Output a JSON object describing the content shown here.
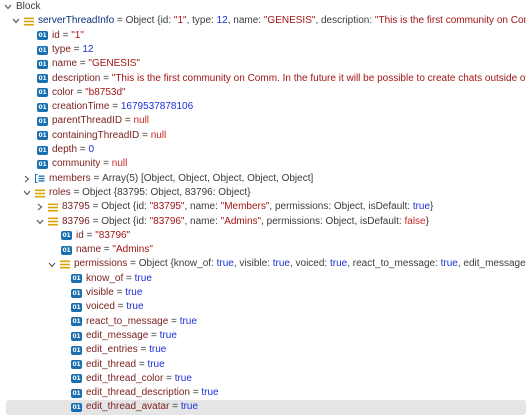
{
  "colors": {
    "string": "#a31515",
    "number": "#1a2fd6",
    "keyword": "#1a2fd6",
    "key": "#7a1e1e",
    "object_icon": "#d9a400",
    "primitive_icon": "#1a6fb0",
    "selected_row": "#e5e5e5"
  },
  "root": {
    "label": "Block"
  },
  "serverThreadInfo": {
    "key": "serverThreadInfo",
    "preview_prefix": "Object {id: ",
    "preview_id": "\"1\"",
    "preview_mid1": ", type: ",
    "preview_type": "12",
    "preview_mid2": ", name: ",
    "preview_name": "\"GENESIS\"",
    "preview_mid3": ", description: ",
    "preview_desc": "\"This is the first community on Comm. In the fut"
  },
  "fields": {
    "id": {
      "key": "id",
      "value": "\"1\""
    },
    "type": {
      "key": "type",
      "value": "12"
    },
    "name": {
      "key": "name",
      "value": "\"GENESIS\""
    },
    "description": {
      "key": "description",
      "value": "\"This is the first community on Comm. In the future it will be possible to create chats outside of a commun"
    },
    "color": {
      "key": "color",
      "value": "\"b8753d\""
    },
    "creationTime": {
      "key": "creationTime",
      "value": "1679537878106"
    },
    "parentThreadID": {
      "key": "parentThreadID",
      "value": "null"
    },
    "containingThreadID": {
      "key": "containingThreadID",
      "value": "null"
    },
    "depth": {
      "key": "depth",
      "value": "0"
    },
    "community": {
      "key": "community",
      "value": "null"
    }
  },
  "members": {
    "key": "members",
    "value": "Array(5) [Object, Object, Object, Object, Object]"
  },
  "roles": {
    "key": "roles",
    "value": "Object {83795: Object, 83796: Object}"
  },
  "role_83795": {
    "key": "83795",
    "prefix": "Object {id: ",
    "id": "\"83795\"",
    "mid1": ", name: ",
    "name": "\"Members\"",
    "mid2": ", permissions: Object, isDefault: ",
    "isDefault": "true",
    "suffix": "}"
  },
  "role_83796": {
    "key": "83796",
    "prefix": "Object {id: ",
    "id": "\"83796\"",
    "mid1": ", name: ",
    "name": "\"Admins\"",
    "mid2": ", permissions: Object, isDefault: ",
    "isDefault": "false",
    "suffix": "}",
    "id_field": {
      "key": "id",
      "value": "\"83796\""
    },
    "name_field": {
      "key": "name",
      "value": "\"Admins\""
    }
  },
  "permissions": {
    "key": "permissions",
    "prefix": "Object {know_of: ",
    "v1": "true",
    "mid1": ", visible: ",
    "v2": "true",
    "mid2": ", voiced: ",
    "v3": "true",
    "mid3": ", react_to_message: ",
    "v4": "true",
    "mid4": ", edit_message: ",
    "v5": "true",
    "suffix": ", …}",
    "items": [
      {
        "key": "know_of",
        "value": "true"
      },
      {
        "key": "visible",
        "value": "true"
      },
      {
        "key": "voiced",
        "value": "true"
      },
      {
        "key": "react_to_message",
        "value": "true"
      },
      {
        "key": "edit_message",
        "value": "true"
      },
      {
        "key": "edit_entries",
        "value": "true"
      },
      {
        "key": "edit_thread",
        "value": "true"
      },
      {
        "key": "edit_thread_color",
        "value": "true"
      },
      {
        "key": "edit_thread_description",
        "value": "true"
      },
      {
        "key": "edit_thread_avatar",
        "value": "true"
      }
    ]
  },
  "labels": {
    "eq": " = ",
    "prim_badge": "01"
  }
}
